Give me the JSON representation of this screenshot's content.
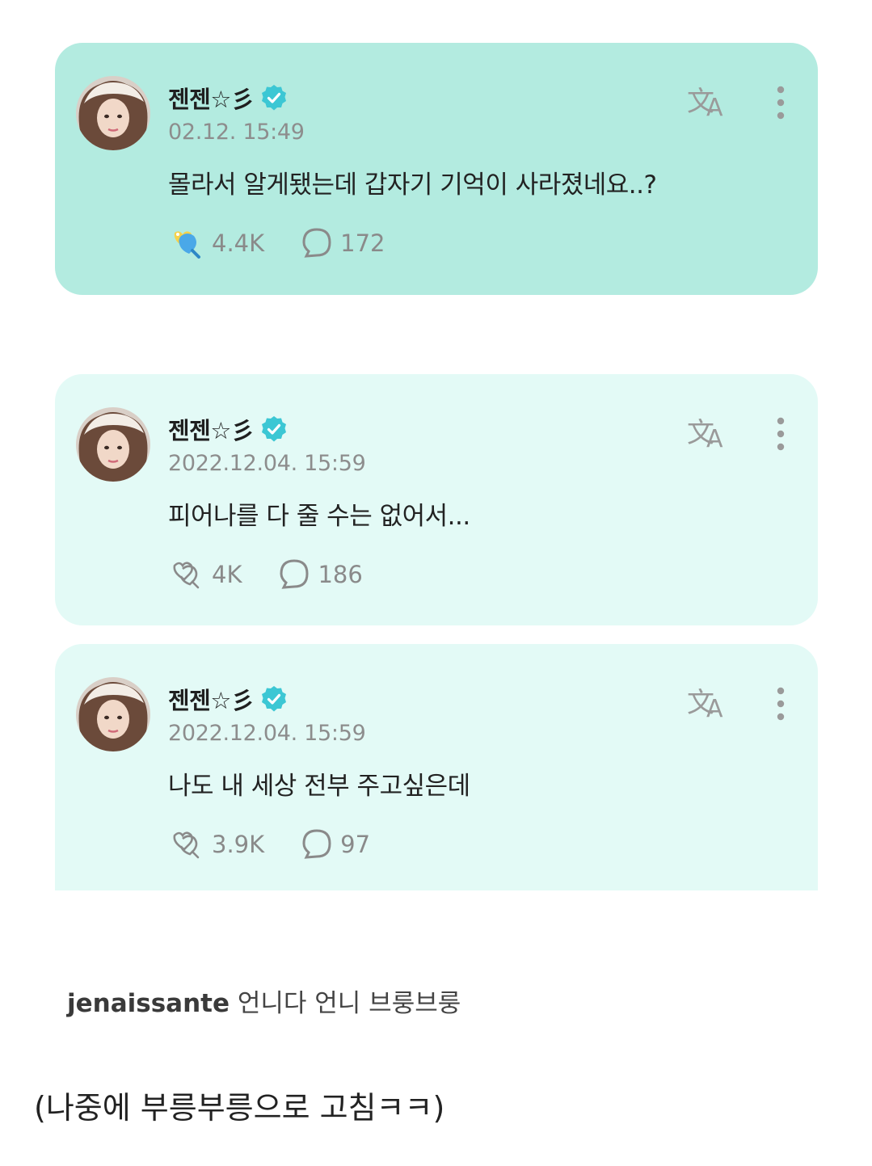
{
  "colors": {
    "highlight_card": "#b3ebe0",
    "card": "#e3faf6",
    "verified_badge": "#3cc7d4",
    "meta_text": "#8d8d8d"
  },
  "posts": [
    {
      "author": "젠젠☆彡",
      "date": "02.12. 15:49",
      "text": "몰라서 알게됐는데 갑자기 기억이 사라졌네요..?",
      "likes": "4.4K",
      "comments": "172",
      "liked": true,
      "icons": {
        "translate": "translate-icon",
        "more": "more-vertical-icon",
        "like": "reaction-icon",
        "comment": "comment-bubble-icon"
      }
    },
    {
      "author": "젠젠☆彡",
      "date": "2022.12.04. 15:59",
      "text": "피어나를 다 줄 수는 없어서...",
      "likes": "4K",
      "comments": "186",
      "liked": false,
      "icons": {
        "translate": "translate-icon",
        "more": "more-vertical-icon",
        "like": "reaction-icon",
        "comment": "comment-bubble-icon"
      }
    },
    {
      "author": "젠젠☆彡",
      "date": "2022.12.04. 15:59",
      "text": "나도 내 세상 전부 주고싶은데",
      "likes": "3.9K",
      "comments": "97",
      "liked": false,
      "icons": {
        "translate": "translate-icon",
        "more": "more-vertical-icon",
        "like": "reaction-icon",
        "comment": "comment-bubble-icon"
      }
    }
  ],
  "comment": {
    "user": "jenaissante",
    "text": "언니다 언니 브룽브룽"
  },
  "footer_note": "(나중에 부릉부릉으로 고침ㅋㅋ)"
}
